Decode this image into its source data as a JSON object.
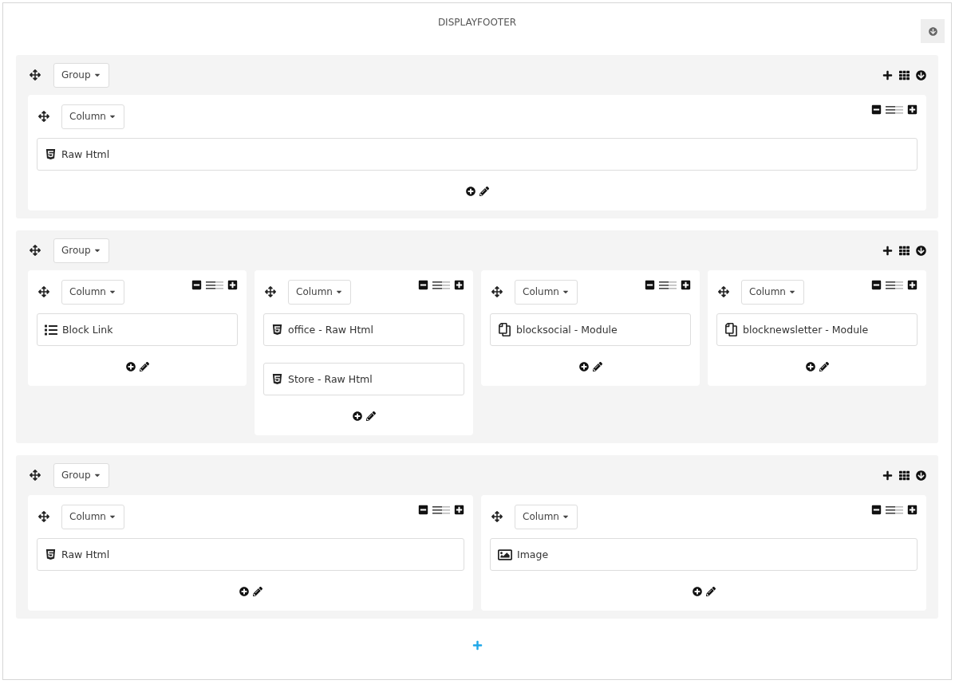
{
  "hook": {
    "title": "DISPLAYFOOTER"
  },
  "groups": [
    {
      "label": "Group",
      "columns": [
        {
          "label": "Column",
          "modules": [
            {
              "kind": "html",
              "name": "Raw Html"
            }
          ]
        }
      ]
    },
    {
      "label": "Group",
      "columns": [
        {
          "label": "Column",
          "modules": [
            {
              "kind": "list",
              "name": "Block Link"
            }
          ]
        },
        {
          "label": "Column",
          "modules": [
            {
              "kind": "html",
              "name": "office - Raw Html"
            },
            {
              "kind": "html",
              "name": "Store - Raw Html"
            }
          ]
        },
        {
          "label": "Column",
          "modules": [
            {
              "kind": "module",
              "name": "blocksocial - Module"
            }
          ]
        },
        {
          "label": "Column",
          "modules": [
            {
              "kind": "module",
              "name": "blocknewsletter - Module"
            }
          ]
        }
      ]
    },
    {
      "label": "Group",
      "columns": [
        {
          "label": "Column",
          "modules": [
            {
              "kind": "html",
              "name": "Raw Html"
            }
          ]
        },
        {
          "label": "Column",
          "modules": [
            {
              "kind": "image",
              "name": "Image"
            }
          ]
        }
      ]
    }
  ]
}
